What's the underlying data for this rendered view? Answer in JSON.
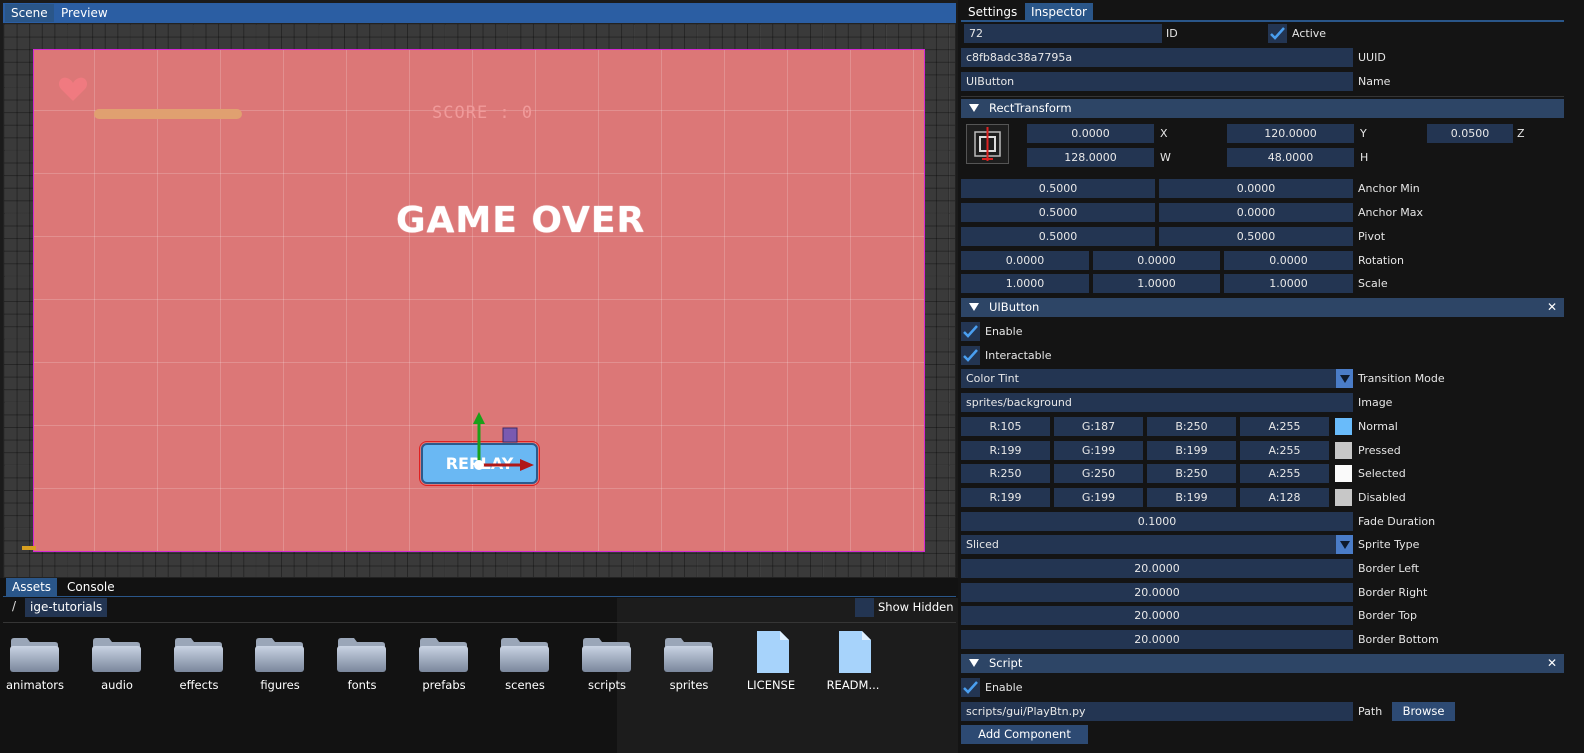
{
  "scene_tabs": [
    "Scene",
    "Preview"
  ],
  "game": {
    "score_text": "SCORE : 0",
    "title_text": "GAME OVER",
    "button_text": "REPLAY"
  },
  "bottom_tabs": [
    "Assets",
    "Console"
  ],
  "assets": {
    "path_root": "/",
    "path_current": "ige-tutorials",
    "show_hidden_label": "Show Hidden",
    "items": [
      {
        "name": "animators",
        "type": "folder"
      },
      {
        "name": "audio",
        "type": "folder"
      },
      {
        "name": "effects",
        "type": "folder"
      },
      {
        "name": "figures",
        "type": "folder"
      },
      {
        "name": "fonts",
        "type": "folder"
      },
      {
        "name": "prefabs",
        "type": "folder"
      },
      {
        "name": "scenes",
        "type": "folder"
      },
      {
        "name": "scripts",
        "type": "folder"
      },
      {
        "name": "sprites",
        "type": "folder"
      },
      {
        "name": "LICENSE",
        "type": "file"
      },
      {
        "name": "READM...",
        "type": "file"
      }
    ]
  },
  "inspector_tabs": [
    "Settings",
    "Inspector"
  ],
  "object": {
    "id": "72",
    "id_label": "ID",
    "active_label": "Active",
    "active": true,
    "uuid": "c8fb8adc38a7795a",
    "uuid_label": "UUID",
    "name": "UIButton",
    "name_label": "Name"
  },
  "rect_transform": {
    "header": "RectTransform",
    "x": "0.0000",
    "x_label": "X",
    "y": "120.0000",
    "y_label": "Y",
    "z": "0.0500",
    "z_label": "Z",
    "w": "128.0000",
    "w_label": "W",
    "h": "48.0000",
    "h_label": "H",
    "anchor_min": [
      "0.5000",
      "0.0000"
    ],
    "anchor_min_label": "Anchor Min",
    "anchor_max": [
      "0.5000",
      "0.0000"
    ],
    "anchor_max_label": "Anchor Max",
    "pivot": [
      "0.5000",
      "0.5000"
    ],
    "pivot_label": "Pivot",
    "rotation": [
      "0.0000",
      "0.0000",
      "0.0000"
    ],
    "rotation_label": "Rotation",
    "scale": [
      "1.0000",
      "1.0000",
      "1.0000"
    ],
    "scale_label": "Scale"
  },
  "ui_button": {
    "header": "UIButton",
    "enable_label": "Enable",
    "interactable_label": "Interactable",
    "transition_mode": "Color Tint",
    "transition_mode_label": "Transition Mode",
    "image": "sprites/background",
    "image_label": "Image",
    "colors": [
      {
        "r": "R:105",
        "g": "G:187",
        "b": "B:250",
        "a": "A:255",
        "swatch": "#69bbfa",
        "label": "Normal"
      },
      {
        "r": "R:199",
        "g": "G:199",
        "b": "B:199",
        "a": "A:255",
        "swatch": "#c7c7c7",
        "label": "Pressed"
      },
      {
        "r": "R:250",
        "g": "G:250",
        "b": "B:250",
        "a": "A:255",
        "swatch": "#fafafa",
        "label": "Selected"
      },
      {
        "r": "R:199",
        "g": "G:199",
        "b": "B:199",
        "a": "A:128",
        "swatch": "#c7c7c7",
        "label": "Disabled"
      }
    ],
    "fade_duration": "0.1000",
    "fade_duration_label": "Fade Duration",
    "sprite_type": "Sliced",
    "sprite_type_label": "Sprite Type",
    "border_left": "20.0000",
    "border_left_label": "Border Left",
    "border_right": "20.0000",
    "border_right_label": "Border Right",
    "border_top": "20.0000",
    "border_top_label": "Border Top",
    "border_bottom": "20.0000",
    "border_bottom_label": "Border Bottom"
  },
  "script": {
    "header": "Script",
    "enable_label": "Enable",
    "path": "scripts/gui/PlayBtn.py",
    "path_label": "Path",
    "browse_label": "Browse"
  },
  "add_component_label": "Add Component",
  "colors": {
    "accent": "#2a5689",
    "field": "#233552",
    "section": "#2d4566",
    "canvas": "#dc7777"
  }
}
